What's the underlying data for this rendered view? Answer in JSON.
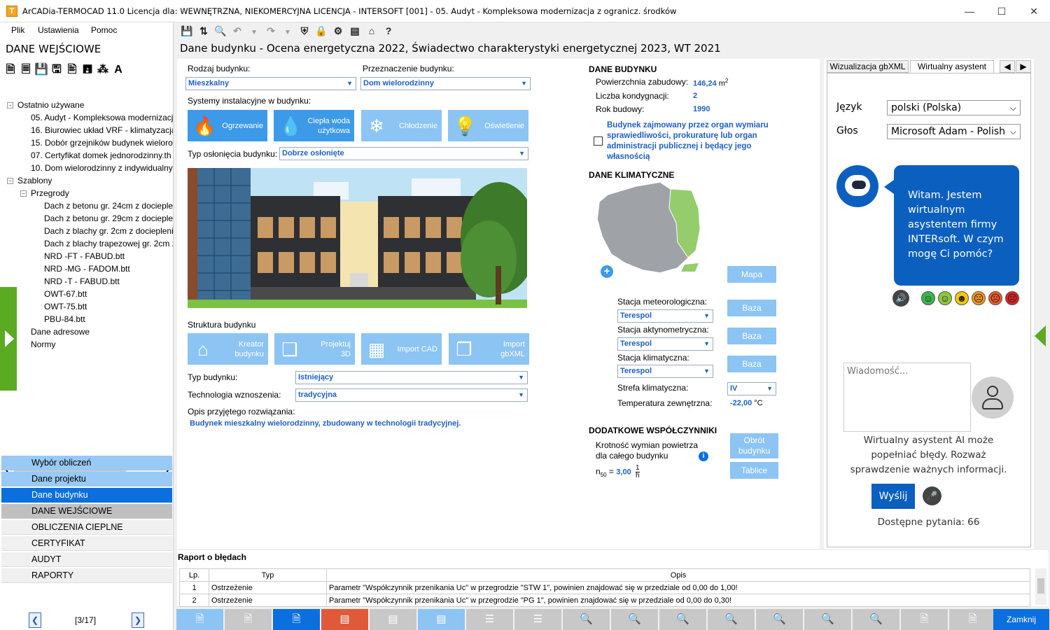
{
  "window": {
    "title": "ArCADia-TERMOCAD 11.0 Licencja dla: WEWNĘTRZNA, NIEKOMERCYJNA LICENCJA - INTERSOFT [001] - 05. Audyt - Kompleksowa modernizacja z ogranicz. środków",
    "app_icon": "T"
  },
  "menu": [
    "Plik",
    "Ustawienia",
    "Pomoc"
  ],
  "left": {
    "title": "DANE WEJŚCIOWE",
    "tree": {
      "recent_label": "Ostatnio używane",
      "recent": [
        "05. Audyt - Kompleksowa modernizacja",
        "16. Biurowiec układ VRF - klimatyzacja",
        "15. Dobór grzejników budynek wieloro",
        "07. Certyfikat domek jednorodzinny.th",
        "10. Dom wielorodzinny z indywidualny"
      ],
      "templates_label": "Szablony",
      "partitions_label": "Przegrody",
      "partitions": [
        "Dach z betonu gr. 24cm z docieplen",
        "Dach z betonu gr. 29cm z docieplen",
        "Dach z blachy gr. 2cm z docieplenie",
        "Dach z blachy trapezowej gr. 2cm z",
        "NRD -FT - FABUD.btt",
        "NRD -MG - FADOM.btt",
        "NRD -T - FABUD.btt",
        "OWT-67.btt",
        "OWT-75.btt",
        "PBU-84.btt"
      ],
      "address_label": "Dane adresowe",
      "norms_label": "Normy"
    },
    "nav": [
      "Wybór obliczeń",
      "Dane projektu",
      "Dane budynku",
      "DANE WEJŚCIOWE",
      "OBLICZENIA CIEPLNE",
      "CERTYFIKAT",
      "AUDYT",
      "RAPORTY"
    ],
    "pager": "[3/17]"
  },
  "main": {
    "header": "Dane budynku - Ocena energetyczna 2022, Świadectwo charakterystyki energetycznej 2023, WT 2021",
    "building_type_label": "Rodzaj budynku:",
    "building_type": "Mieszkalny",
    "purpose_label": "Przeznaczenie budynku:",
    "purpose": "Dom wielorodzinny",
    "systems_label": "Systemy instalacyjne w budynku:",
    "systems": [
      "Ogrzewanie",
      "Ciepła woda\nużytkowa",
      "Chłodzenie",
      "Oświetlenie"
    ],
    "shielding_label": "Typ osłonięcia budynku:",
    "shielding": "Dobrze osłonięte",
    "structure_label": "Struktura budynku",
    "structure_buttons": [
      "Kreator\nbudynku",
      "Projektuj\n3D",
      "Import CAD",
      "Import\ngbXML"
    ],
    "type_label": "Typ budynku:",
    "type": "Istniejący",
    "tech_label": "Technologia wznoszenia:",
    "tech": "tradycyjna",
    "desc_label": "Opis przyjętego rozwiązania:",
    "desc": "Budynek mieszkalny wielorodzinny, zbudowany w technologii tradycyjnej."
  },
  "building_data": {
    "title": "DANE BUDYNKU",
    "area_label": "Powierzchnia zabudowy:",
    "area": "146,24",
    "area_unit": "m",
    "area_sup": "2",
    "floors_label": "Liczba kondygnacji:",
    "floors": "2",
    "year_label": "Rok budowy:",
    "year": "1990",
    "justice_text": "Budynek zajmowany przez organ wymiaru sprawiedliwości, prokuraturę lub organ administracji publicznej i będący jego własnością"
  },
  "climate": {
    "title": "DANE KLIMATYCZNE",
    "map_button": "Mapa",
    "met_label": "Stacja meteorologiczna:",
    "met": "Terespol",
    "act_label": "Stacja aktynometryczna:",
    "act": "Terespol",
    "clim_label": "Stacja klimatyczna:",
    "clim": "Terespol",
    "base_button": "Baza",
    "zone_label": "Strefa klimatyczna:",
    "zone": "IV",
    "temp_label": "Temperatura zewnętrzna:",
    "temp": "-22,00",
    "temp_unit": "°C"
  },
  "coeffs": {
    "title": "DODATKOWE WSPÓŁCZYNNIKI",
    "air_label": "Krotność wymian powietrza\ndla całego budynku",
    "n50_prefix": "n",
    "n50_sub": "50",
    "n50_eq": " = ",
    "n50": "3,00",
    "n50_num": "1",
    "n50_den": "h",
    "rotate_button": "Obrót\nbudynku",
    "tables_button": "Tablice"
  },
  "right": {
    "tabs": [
      "Wizualizacja gbXML",
      "Wirtualny asystent"
    ],
    "lang_label": "Język",
    "lang": "polski (Polska)",
    "voice_label": "Głos",
    "voice": "Microsoft Adam - Polish",
    "bubble": "Witam. Jestem wirtualnym asystentem firmy INTERsoft. W czym mogę Ci pomóc?",
    "message_placeholder": "Wiadomość...",
    "disclaimer": "Wirtualny asystent AI może popełniać błędy. Rozważ sprawdzenie ważnych informacji.",
    "send": "Wyślij",
    "questions": "Dostępne pytania: 66",
    "emoji_colors": [
      "#3ab54a",
      "#8cc63f",
      "#f7c600",
      "#f7941d",
      "#f15a24",
      "#e02020"
    ]
  },
  "report": {
    "title": "Raport o błędach",
    "headers": [
      "Lp.",
      "Typ",
      "Opis"
    ],
    "rows": [
      [
        "1",
        "Ostrzeżenie",
        "Parametr \"Współczynnik przenikania Uc\" w przegrodzie \"STW 1\", powinien znajdować się w przedziale od 0,00 do 1,00!"
      ],
      [
        "2",
        "Ostrzeżenie",
        "Parametr \"Współczynnik przenikania Uc\" w przegrodzie \"PG 1\", powinien znajdować się w przedziale od 0,00 do 0,30!"
      ]
    ]
  },
  "close_button": "Zamknij",
  "colors": {
    "accent": "#3d9ae8",
    "accent_light": "#8cc4f3",
    "nav_selected": "#0b6fe0",
    "green": "#5aaa22",
    "error": "#e05a3a",
    "bubble": "#0b5fbf"
  }
}
